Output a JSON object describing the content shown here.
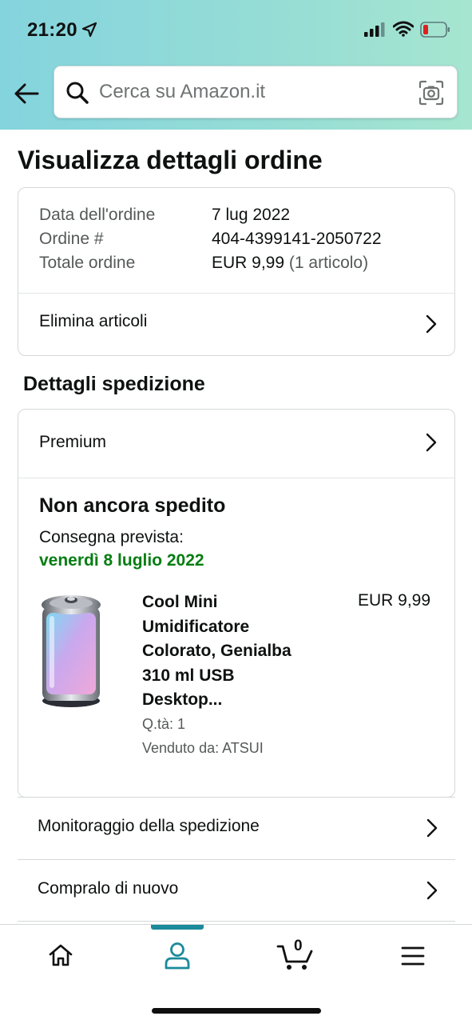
{
  "status_bar": {
    "time": "21:20"
  },
  "search": {
    "placeholder": "Cerca su Amazon.it"
  },
  "page": {
    "title": "Visualizza dettagli ordine"
  },
  "order": {
    "date_label": "Data dell'ordine",
    "date_value": "7 lug 2022",
    "number_label": "Ordine #",
    "number_value": "404-4399141-2050722",
    "total_label": "Totale ordine",
    "total_value": "EUR 9,99",
    "total_items": "(1 articolo)",
    "delete_items": "Elimina articoli"
  },
  "shipment": {
    "section_title": "Dettagli spedizione",
    "service": "Premium",
    "status": "Non ancora spedito",
    "delivery_label": "Consegna prevista:",
    "delivery_date": "venerdì 8 luglio 2022",
    "product": {
      "title": "Cool Mini Umidificatore Colorato, Genialba 310 ml USB Desktop...",
      "price": "EUR 9,99",
      "quantity": "Q.tà: 1",
      "seller": "Venduto da: ATSUI"
    }
  },
  "actions": {
    "track": "Monitoraggio della spedizione",
    "buy_again": "Compralo di nuovo"
  },
  "bottom_nav": {
    "cart_count": "0",
    "active": "account",
    "accent": "#1b8a9a"
  },
  "colors": {
    "delivery_green": "#067d12",
    "header_gradient_start": "#84d4de",
    "header_gradient_end": "#a6e6d0"
  },
  "icons": [
    "location-arrow-icon",
    "signal-icon",
    "wifi-icon",
    "battery-icon",
    "back-arrow-icon",
    "search-icon",
    "camera-icon",
    "chevron-right-icon",
    "home-icon",
    "account-icon",
    "cart-icon",
    "menu-icon"
  ]
}
